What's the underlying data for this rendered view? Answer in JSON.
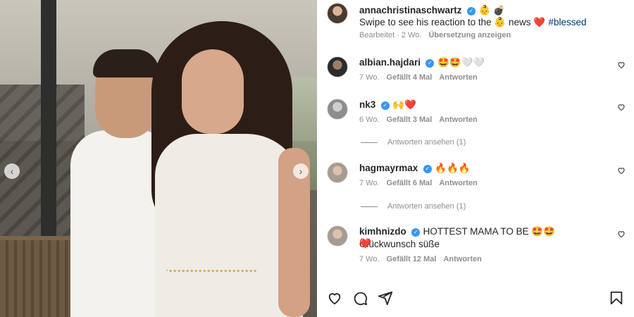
{
  "post": {
    "author": "annachristinaschwartz",
    "author_emojis": "👶 💣",
    "caption_prefix": "Swipe to see his reaction to the ",
    "caption_baby": "👶",
    "caption_news": " news ",
    "caption_heart": "❤️",
    "caption_hashtag": "#blessed",
    "edited_meta": "Bearbeitet · 2 Wo.",
    "translate_link": "Übersetzung anzeigen"
  },
  "comments": [
    {
      "username": "albian.hajdari",
      "text": "🤩🤩🤍🤍",
      "age": "7 Wo.",
      "likes": "Gefällt 4 Mal",
      "reply": "Antworten"
    },
    {
      "username": "nk3",
      "text": "🙌❤️",
      "age": "6 Wo.",
      "likes": "Gefällt 3 Mal",
      "reply": "Antworten",
      "view_replies": "Antworten ansehen (1)"
    },
    {
      "username": "hagmayrmax",
      "text": "🔥🔥🔥",
      "age": "7 Wo.",
      "likes": "Gefällt 6 Mal",
      "reply": "Antworten",
      "view_replies": "Antworten ansehen (1)"
    },
    {
      "username": "kimhnizdo",
      "text": "HOTTEST MAMA TO BE 🤩🤩 Glückwunsch süße",
      "text_line2": "❤️",
      "age": "7 Wo.",
      "likes": "Gefällt 12 Mal",
      "reply": "Antworten"
    }
  ],
  "icons": {
    "verified": "✓",
    "prev": "‹",
    "next": "›"
  },
  "colors": {
    "verified_blue": "#3897f0",
    "link_blue": "#00376b",
    "meta_gray": "#8e8e8e",
    "text_dark": "#262626"
  }
}
